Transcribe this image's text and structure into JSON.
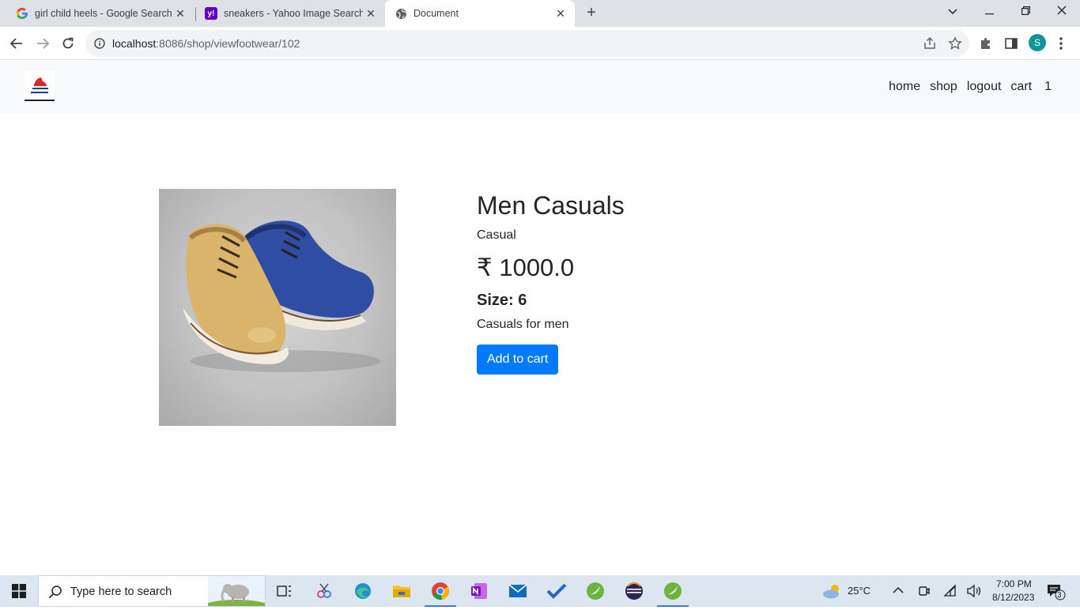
{
  "browser": {
    "tabs": [
      {
        "title": "girl child heels - Google Search",
        "favicon": "google-g-icon"
      },
      {
        "title": "sneakers - Yahoo Image Search R",
        "favicon": "yahoo-icon"
      },
      {
        "title": "Document",
        "favicon": "globe-icon",
        "active": true
      }
    ],
    "url_host": "localhost",
    "url_path": ":8086/shop/viewfootwear/102",
    "profile_initial": "S"
  },
  "navbar": {
    "brand_icon": "shoe-shop-logo",
    "links": [
      "home",
      "shop",
      "logout",
      "cart"
    ],
    "cart_count": "1"
  },
  "product": {
    "name": "Men Casuals",
    "category": "Casual",
    "price": "₹ 1000.0",
    "size_label": "Size: 6",
    "description": "Casuals for men",
    "add_button": "Add to cart",
    "image_icon": "leather-shoes-image"
  },
  "taskbar": {
    "search_placeholder": "Type here to search",
    "weather": "25°C",
    "time": "7:00 PM",
    "date": "8/12/2023",
    "notification_count": "3"
  },
  "colors": {
    "button_primary": "#007bff",
    "navbar_bg": "#f8f9fa",
    "tabstrip_bg": "#dee1e6",
    "taskbar_bg": "#dbe6f1"
  }
}
